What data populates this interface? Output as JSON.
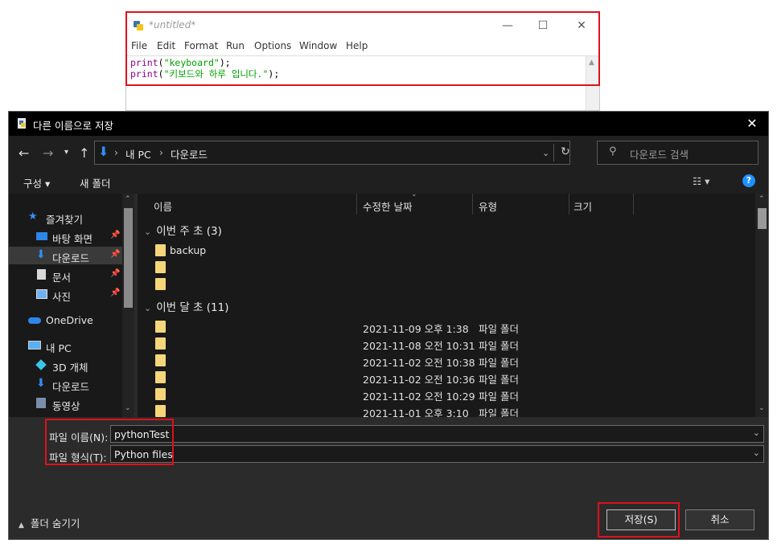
{
  "idle": {
    "title": "*untitled*",
    "menu": [
      "File",
      "Edit",
      "Format",
      "Run",
      "Options",
      "Window",
      "Help"
    ],
    "code": [
      {
        "kw": "print",
        "open": "(",
        "str": "\"keyboard\"",
        "close": ");"
      },
      {
        "kw": "print",
        "open": "(",
        "str": "\"키보드와 하루 입니다.\"",
        "close": ");"
      }
    ]
  },
  "dialog": {
    "title": "다른 이름으로 저장",
    "breadcrumb": [
      "내 PC",
      "다운로드"
    ],
    "search_placeholder": "다운로드 검색",
    "toolbar": {
      "organize": "구성 ▾",
      "new_folder": "새 폴더"
    },
    "nav": {
      "quick_access": "즐겨찾기",
      "desktop": "바탕 화면",
      "downloads": "다운로드",
      "documents": "문서",
      "pictures": "사진",
      "onedrive": "OneDrive",
      "this_pc": "내 PC",
      "objects3d": "3D 개체",
      "pc_downloads": "다운로드",
      "videos": "동영상"
    },
    "columns": {
      "name": "이름",
      "modified": "수정한 날짜",
      "type": "유형",
      "size": "크기"
    },
    "groups": [
      {
        "label": "이번 주 초 (3)",
        "items": [
          {
            "name": "backup",
            "date": "",
            "type": ""
          },
          {
            "name": "",
            "date": "",
            "type": ""
          },
          {
            "name": "",
            "date": "",
            "type": ""
          }
        ]
      },
      {
        "label": "이번 달 초 (11)",
        "items": [
          {
            "name": "",
            "date": "2021-11-09 오후 1:38",
            "type": "파일 폴더"
          },
          {
            "name": "",
            "date": "2021-11-08 오전 10:31",
            "type": "파일 폴더"
          },
          {
            "name": "",
            "date": "2021-11-02 오전 10:38",
            "type": "파일 폴더"
          },
          {
            "name": "",
            "date": "2021-11-02 오전 10:36",
            "type": "파일 폴더"
          },
          {
            "name": "",
            "date": "2021-11-02 오전 10:29",
            "type": "파일 폴더"
          },
          {
            "name": "",
            "date": "2021-11-01 오후 3:10",
            "type": "파일 폴더"
          }
        ]
      }
    ],
    "filename_label": "파일 이름(N):",
    "filename_value": "pythonTest",
    "filetype_label": "파일 형식(T):",
    "filetype_value": "Python files",
    "hide_folders": "폴더 숨기기",
    "save_button": "저장(S)",
    "cancel_button": "취소"
  },
  "colors": {
    "highlight": "#e0101c",
    "dialog_bg": "#2b2b2b",
    "folder": "#f5d67a",
    "accent": "#1e90ff"
  }
}
